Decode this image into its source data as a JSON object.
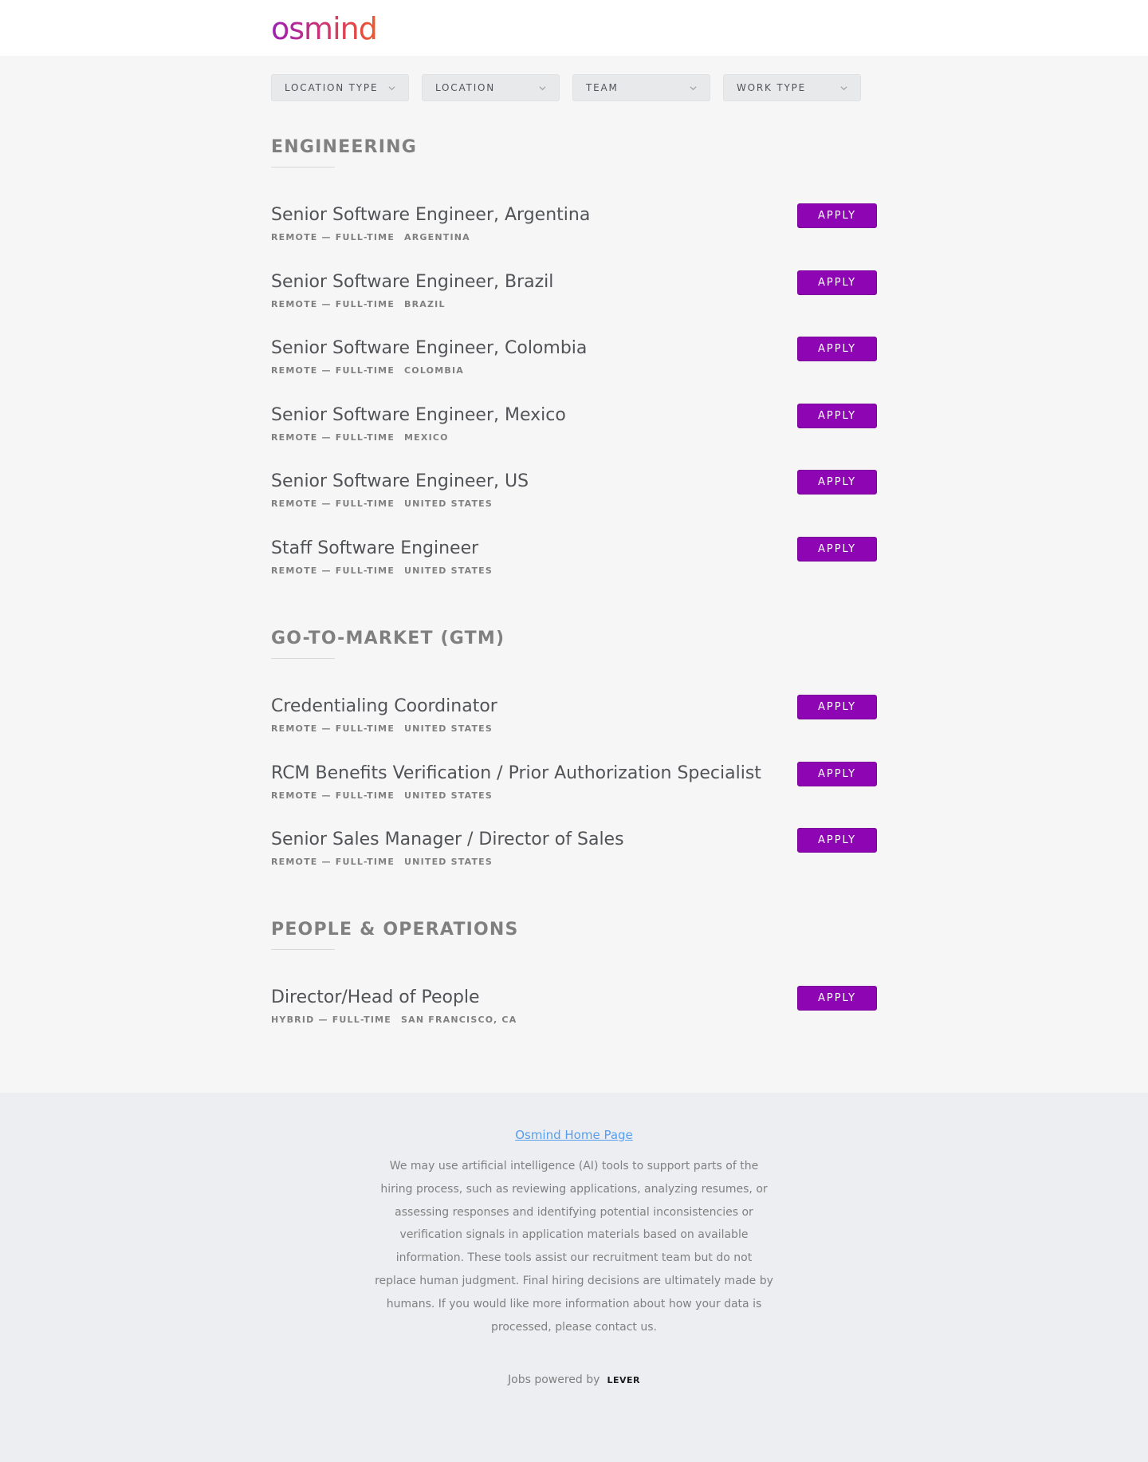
{
  "header": {
    "logo_text": "osmind"
  },
  "filters": [
    {
      "label": "LOCATION TYPE"
    },
    {
      "label": "LOCATION"
    },
    {
      "label": "TEAM"
    },
    {
      "label": "WORK TYPE"
    }
  ],
  "groups": [
    {
      "title": "ENGINEERING",
      "postings": [
        {
          "title": "Senior Software Engineer, Argentina",
          "commitment": "REMOTE — FULL-TIME",
          "location": "ARGENTINA",
          "apply": "APPLY"
        },
        {
          "title": "Senior Software Engineer, Brazil",
          "commitment": "REMOTE — FULL-TIME",
          "location": "BRAZIL",
          "apply": "APPLY"
        },
        {
          "title": "Senior Software Engineer, Colombia",
          "commitment": "REMOTE — FULL-TIME",
          "location": "COLOMBIA",
          "apply": "APPLY"
        },
        {
          "title": "Senior Software Engineer, Mexico",
          "commitment": "REMOTE — FULL-TIME",
          "location": "MEXICO",
          "apply": "APPLY"
        },
        {
          "title": "Senior Software Engineer, US",
          "commitment": "REMOTE — FULL-TIME",
          "location": "UNITED STATES",
          "apply": "APPLY"
        },
        {
          "title": "Staff Software Engineer",
          "commitment": "REMOTE — FULL-TIME",
          "location": "UNITED STATES",
          "apply": "APPLY"
        }
      ]
    },
    {
      "title": "GO-TO-MARKET (GTM)",
      "postings": [
        {
          "title": "Credentialing Coordinator",
          "commitment": "REMOTE — FULL-TIME",
          "location": "UNITED STATES",
          "apply": "APPLY"
        },
        {
          "title": "RCM Benefits Verification / Prior Authorization Specialist",
          "commitment": "REMOTE — FULL-TIME",
          "location": "UNITED STATES",
          "apply": "APPLY"
        },
        {
          "title": "Senior Sales Manager / Director of Sales",
          "commitment": "REMOTE — FULL-TIME",
          "location": "UNITED STATES",
          "apply": "APPLY"
        }
      ]
    },
    {
      "title": "PEOPLE & OPERATIONS",
      "postings": [
        {
          "title": "Director/Head of People",
          "commitment": "HYBRID — FULL-TIME",
          "location": "SAN FRANCISCO, CA",
          "apply": "APPLY"
        }
      ]
    }
  ],
  "footer": {
    "home_link": "Osmind Home Page",
    "ai_note": "We may use artificial intelligence (AI) tools to support parts of the hiring process, such as reviewing applications, analyzing resumes, or assessing responses and identifying potential inconsistencies or verification signals in application materials based on available information. These tools assist our recruitment team but do not replace human judgment. Final hiring decisions are ultimately made by humans. If you would like more information about how your data is processed, please contact us.",
    "powered_by": "Jobs powered by",
    "lever_logo": "LEVER"
  },
  "colors": {
    "apply_button": "#8e05b4",
    "link": "#579eee",
    "background": "#f6f6f6",
    "footer_background": "#edeef1"
  },
  "icons": {
    "filter_dropdown": "chevron-down-icon"
  }
}
